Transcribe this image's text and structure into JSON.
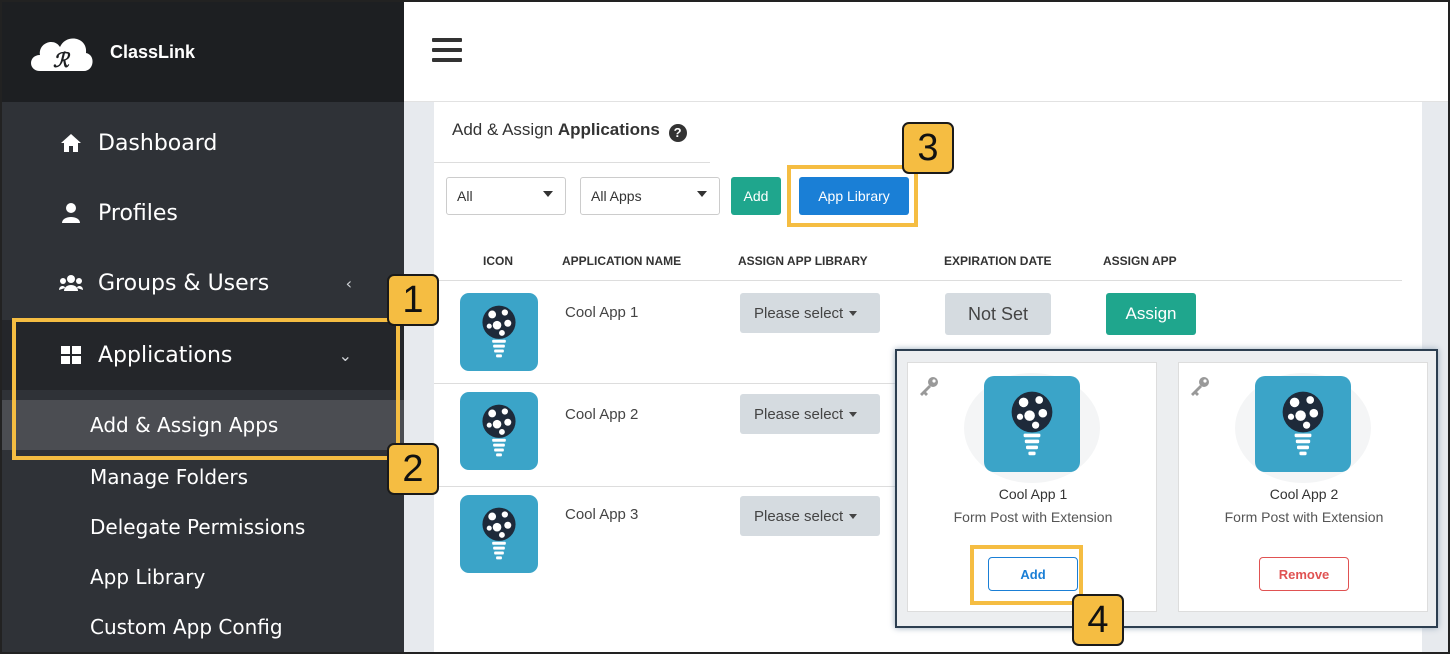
{
  "app": {
    "name": "ClassLink"
  },
  "sidebar": {
    "items": [
      {
        "label": "Dashboard",
        "icon": "home-icon"
      },
      {
        "label": "Profiles",
        "icon": "user-icon"
      },
      {
        "label": "Groups & Users",
        "icon": "users-icon",
        "chevron": "‹"
      },
      {
        "label": "Applications",
        "icon": "grid-icon",
        "chevron": "⌄"
      }
    ],
    "subitems": [
      "Add & Assign Apps",
      "Manage Folders",
      "Delegate Permissions",
      "App Library",
      "Custom App Config"
    ]
  },
  "panel": {
    "title_prefix": "Add & Assign ",
    "title_bold": "Applications",
    "filter1": "All",
    "filter2": "All Apps",
    "add_label": "Add",
    "app_library_label": "App Library"
  },
  "table": {
    "headers": [
      "ICON",
      "APPLICATION NAME",
      "ASSIGN APP LIBRARY",
      "EXPIRATION DATE",
      "ASSIGN APP"
    ],
    "rows": [
      {
        "name": "Cool App 1",
        "library": "Please select",
        "expiration": "Not Set",
        "assign": "Assign"
      },
      {
        "name": "Cool App 2",
        "library": "Please select"
      },
      {
        "name": "Cool App 3",
        "library": "Please select"
      }
    ]
  },
  "popup": {
    "cards": [
      {
        "name": "Cool App 1",
        "type": "Form Post with Extension",
        "action": "Add"
      },
      {
        "name": "Cool App 2",
        "type": "Form Post with Extension",
        "action": "Remove"
      }
    ]
  },
  "callouts": [
    "1",
    "2",
    "3",
    "4"
  ],
  "colors": {
    "highlight": "#f5bd42",
    "teal": "#1fa68d",
    "blue": "#1a7fd6",
    "app_icon": "#3ba4c8",
    "remove_red": "#e05252"
  }
}
